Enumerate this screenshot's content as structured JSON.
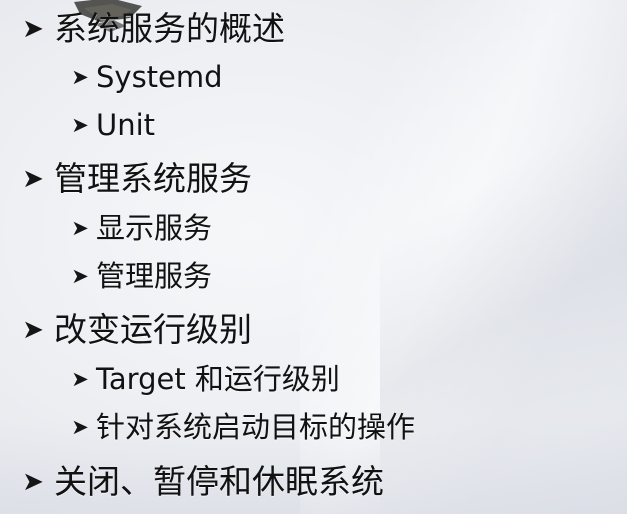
{
  "slide": {
    "bullet_glyph": "➤",
    "items": [
      {
        "label": "系统服务的概述",
        "children": [
          {
            "label": "Systemd"
          },
          {
            "label": "Unit"
          }
        ]
      },
      {
        "label": "管理系统服务",
        "children": [
          {
            "label": "显示服务"
          },
          {
            "label": "管理服务"
          }
        ]
      },
      {
        "label": "改变运行级别",
        "children": [
          {
            "label": "Target 和运行级别"
          },
          {
            "label": "针对系统启动目标的操作"
          }
        ]
      },
      {
        "label": "关闭、暂停和休眠系统",
        "children": []
      }
    ]
  },
  "colors": {
    "text": "#121212",
    "background": "#eceef2"
  },
  "icons": {
    "bullet": "arrowhead-bullet-icon",
    "ornament": "corner-ornament-icon"
  }
}
